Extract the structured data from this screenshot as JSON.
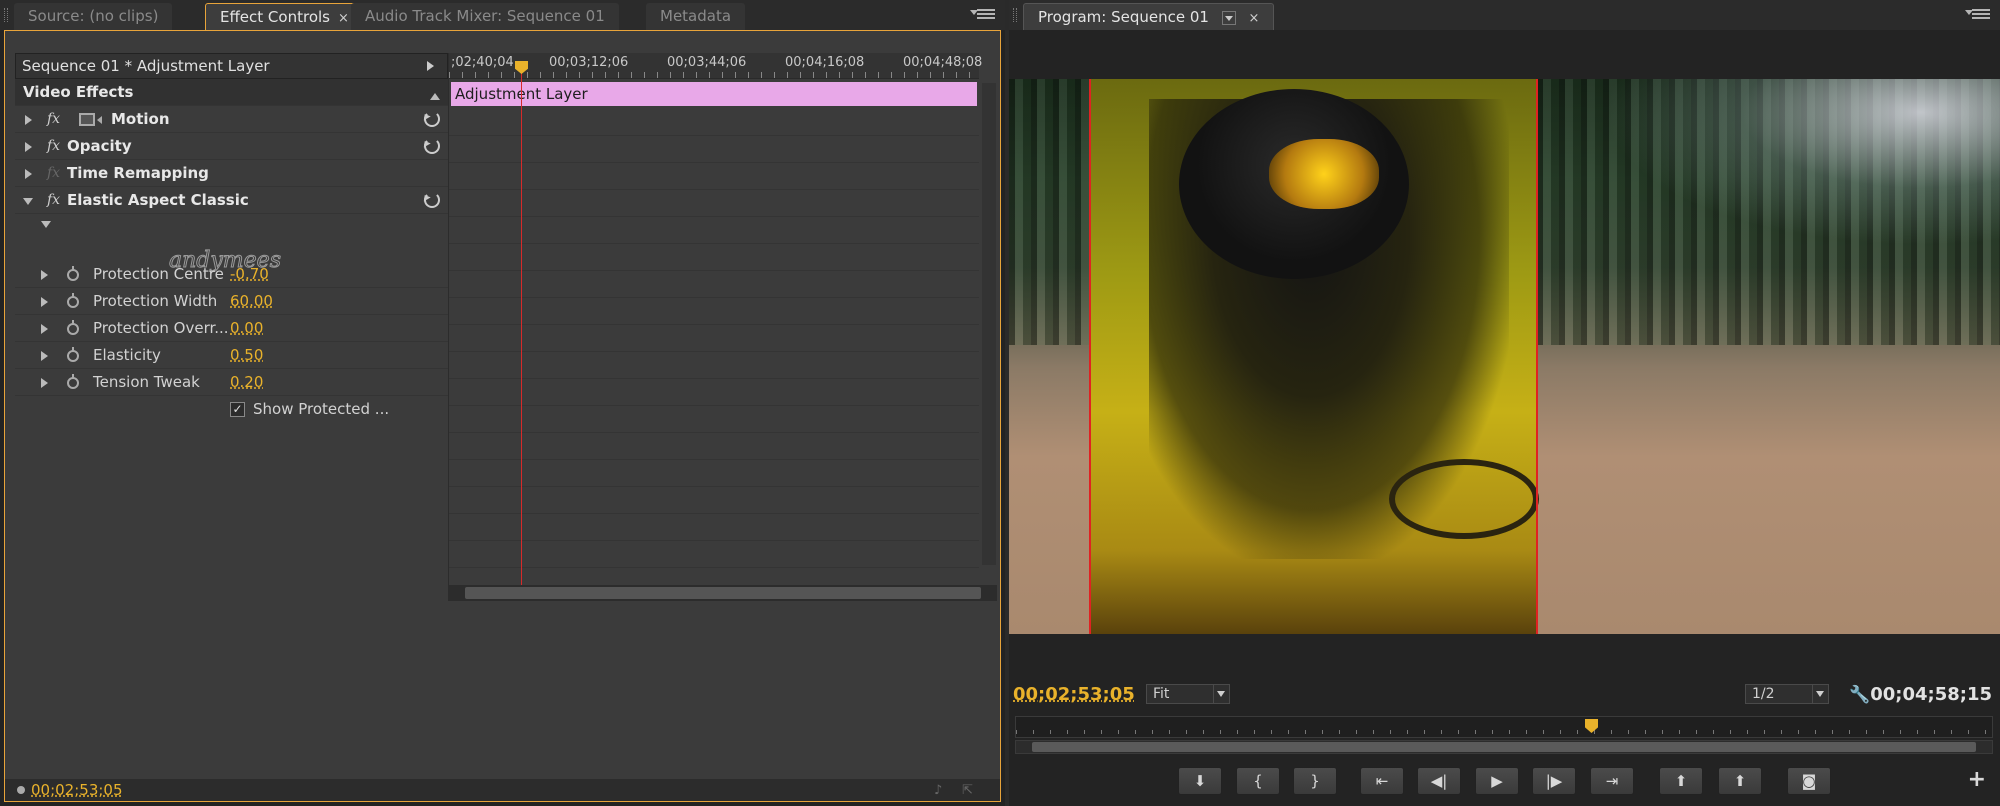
{
  "left_tabs": [
    {
      "label": "Source: (no clips)"
    },
    {
      "label": "Effect Controls",
      "close": "×"
    },
    {
      "label": "Audio Track Mixer: Sequence 01"
    },
    {
      "label": "Metadata"
    }
  ],
  "effect_controls": {
    "clip_header": "Sequence 01 * Adjustment Layer",
    "section_title": "Video Effects",
    "effects": [
      {
        "name": "Motion"
      },
      {
        "name": "Opacity"
      },
      {
        "name": "Time Remapping"
      },
      {
        "name": "Elastic Aspect Classic"
      }
    ],
    "fx_glyph": "fx",
    "logo_text": "andymees",
    "params": [
      {
        "name": "Protection Centre",
        "value": "-0.70"
      },
      {
        "name": "Protection Width",
        "value": "60.00"
      },
      {
        "name": "Protection Overr...",
        "value": "0.00"
      },
      {
        "name": "Elasticity",
        "value": "0.50"
      },
      {
        "name": "Tension Tweak",
        "value": "0.20"
      }
    ],
    "checkbox": {
      "label": "Show Protected ...",
      "checked": true,
      "mark": "✓"
    },
    "ruler_labels": [
      ";02;40;04",
      "00;03;12;06",
      "00;03;44;06",
      "00;04;16;08",
      "00;04;48;08"
    ],
    "clip_label": "Adjustment Layer",
    "footer_timecode": "00;02;53;05"
  },
  "program": {
    "tab_label": "Program: Sequence 01",
    "close": "×",
    "timecode": "00;02;53;05",
    "zoom": "Fit",
    "resolution": "1/2",
    "duration": "00;04;58;15",
    "transport": [
      {
        "icon": "marker-icon",
        "glyph": "⬇"
      },
      {
        "icon": "mark-in-icon",
        "glyph": "{"
      },
      {
        "icon": "mark-out-icon",
        "glyph": "}"
      },
      {
        "icon": "go-to-in-icon",
        "glyph": "⇤"
      },
      {
        "icon": "step-back-icon",
        "glyph": "◀|"
      },
      {
        "icon": "play-icon",
        "glyph": "▶"
      },
      {
        "icon": "step-forward-icon",
        "glyph": "|▶"
      },
      {
        "icon": "go-to-out-icon",
        "glyph": "⇥"
      },
      {
        "icon": "lift-icon",
        "glyph": "⬆"
      },
      {
        "icon": "extract-icon",
        "glyph": "⬆"
      },
      {
        "icon": "export-frame-icon",
        "glyph": "◙"
      }
    ],
    "add_glyph": "+"
  },
  "colors": {
    "accent": "#e9b22b",
    "clip": "#e8a8e8",
    "playhead": "#d62a2a",
    "focus_border": "#e8a43a"
  }
}
